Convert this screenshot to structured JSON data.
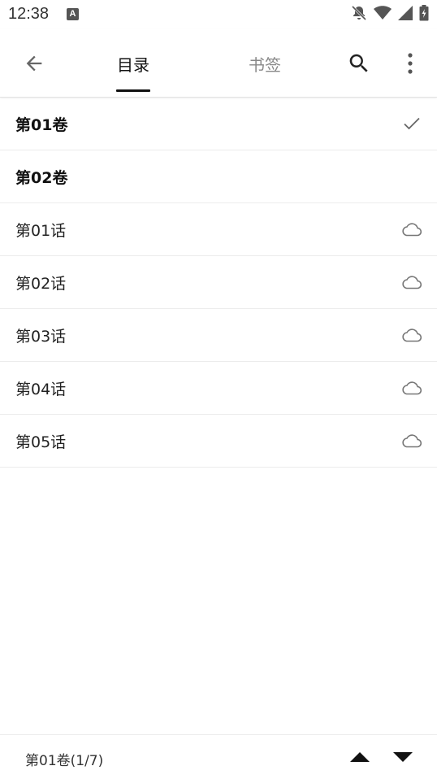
{
  "status_bar": {
    "time": "12:38",
    "app_icon_letter": "A"
  },
  "toolbar": {
    "tabs": [
      {
        "label": "目录",
        "active": true
      },
      {
        "label": "书签",
        "active": false
      }
    ]
  },
  "list": {
    "items": [
      {
        "label": "第01卷",
        "type": "volume",
        "icon": "check-icon"
      },
      {
        "label": "第02卷",
        "type": "volume",
        "icon": ""
      },
      {
        "label": "第01话",
        "type": "chapter",
        "icon": "cloud-icon"
      },
      {
        "label": "第02话",
        "type": "chapter",
        "icon": "cloud-icon"
      },
      {
        "label": "第03话",
        "type": "chapter",
        "icon": "cloud-icon"
      },
      {
        "label": "第04话",
        "type": "chapter",
        "icon": "cloud-icon"
      },
      {
        "label": "第05话",
        "type": "chapter",
        "icon": "cloud-icon"
      }
    ]
  },
  "bottom_bar": {
    "position_label": "第01卷(1/7)"
  },
  "colors": {
    "text_primary": "#111111",
    "text_inactive": "#888888",
    "icon_gray": "#666666"
  }
}
